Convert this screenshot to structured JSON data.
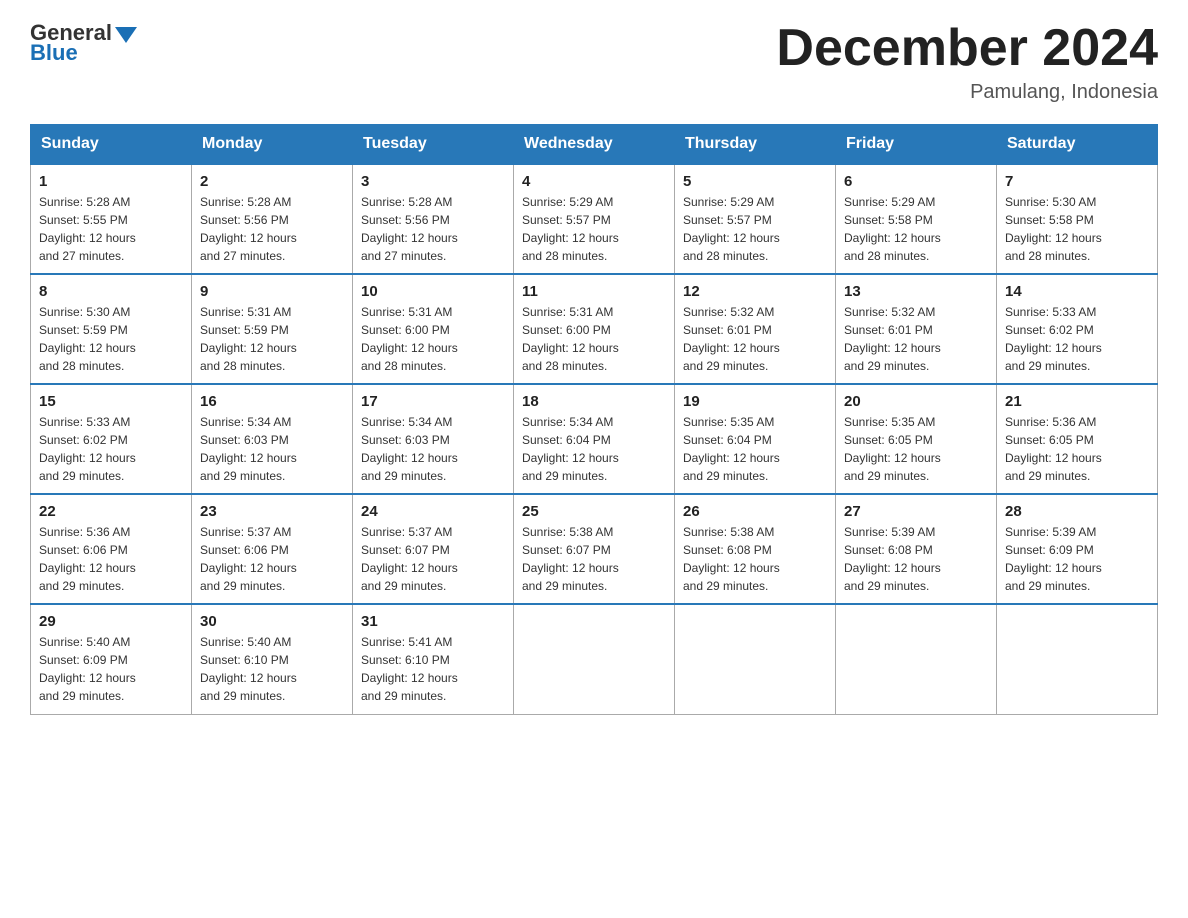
{
  "header": {
    "logo_general": "General",
    "logo_blue": "Blue",
    "month_title": "December 2024",
    "location": "Pamulang, Indonesia"
  },
  "days_of_week": [
    "Sunday",
    "Monday",
    "Tuesday",
    "Wednesday",
    "Thursday",
    "Friday",
    "Saturday"
  ],
  "weeks": [
    [
      {
        "day": "1",
        "sunrise": "5:28 AM",
        "sunset": "5:55 PM",
        "daylight": "12 hours and 27 minutes."
      },
      {
        "day": "2",
        "sunrise": "5:28 AM",
        "sunset": "5:56 PM",
        "daylight": "12 hours and 27 minutes."
      },
      {
        "day": "3",
        "sunrise": "5:28 AM",
        "sunset": "5:56 PM",
        "daylight": "12 hours and 27 minutes."
      },
      {
        "day": "4",
        "sunrise": "5:29 AM",
        "sunset": "5:57 PM",
        "daylight": "12 hours and 28 minutes."
      },
      {
        "day": "5",
        "sunrise": "5:29 AM",
        "sunset": "5:57 PM",
        "daylight": "12 hours and 28 minutes."
      },
      {
        "day": "6",
        "sunrise": "5:29 AM",
        "sunset": "5:58 PM",
        "daylight": "12 hours and 28 minutes."
      },
      {
        "day": "7",
        "sunrise": "5:30 AM",
        "sunset": "5:58 PM",
        "daylight": "12 hours and 28 minutes."
      }
    ],
    [
      {
        "day": "8",
        "sunrise": "5:30 AM",
        "sunset": "5:59 PM",
        "daylight": "12 hours and 28 minutes."
      },
      {
        "day": "9",
        "sunrise": "5:31 AM",
        "sunset": "5:59 PM",
        "daylight": "12 hours and 28 minutes."
      },
      {
        "day": "10",
        "sunrise": "5:31 AM",
        "sunset": "6:00 PM",
        "daylight": "12 hours and 28 minutes."
      },
      {
        "day": "11",
        "sunrise": "5:31 AM",
        "sunset": "6:00 PM",
        "daylight": "12 hours and 28 minutes."
      },
      {
        "day": "12",
        "sunrise": "5:32 AM",
        "sunset": "6:01 PM",
        "daylight": "12 hours and 29 minutes."
      },
      {
        "day": "13",
        "sunrise": "5:32 AM",
        "sunset": "6:01 PM",
        "daylight": "12 hours and 29 minutes."
      },
      {
        "day": "14",
        "sunrise": "5:33 AM",
        "sunset": "6:02 PM",
        "daylight": "12 hours and 29 minutes."
      }
    ],
    [
      {
        "day": "15",
        "sunrise": "5:33 AM",
        "sunset": "6:02 PM",
        "daylight": "12 hours and 29 minutes."
      },
      {
        "day": "16",
        "sunrise": "5:34 AM",
        "sunset": "6:03 PM",
        "daylight": "12 hours and 29 minutes."
      },
      {
        "day": "17",
        "sunrise": "5:34 AM",
        "sunset": "6:03 PM",
        "daylight": "12 hours and 29 minutes."
      },
      {
        "day": "18",
        "sunrise": "5:34 AM",
        "sunset": "6:04 PM",
        "daylight": "12 hours and 29 minutes."
      },
      {
        "day": "19",
        "sunrise": "5:35 AM",
        "sunset": "6:04 PM",
        "daylight": "12 hours and 29 minutes."
      },
      {
        "day": "20",
        "sunrise": "5:35 AM",
        "sunset": "6:05 PM",
        "daylight": "12 hours and 29 minutes."
      },
      {
        "day": "21",
        "sunrise": "5:36 AM",
        "sunset": "6:05 PM",
        "daylight": "12 hours and 29 minutes."
      }
    ],
    [
      {
        "day": "22",
        "sunrise": "5:36 AM",
        "sunset": "6:06 PM",
        "daylight": "12 hours and 29 minutes."
      },
      {
        "day": "23",
        "sunrise": "5:37 AM",
        "sunset": "6:06 PM",
        "daylight": "12 hours and 29 minutes."
      },
      {
        "day": "24",
        "sunrise": "5:37 AM",
        "sunset": "6:07 PM",
        "daylight": "12 hours and 29 minutes."
      },
      {
        "day": "25",
        "sunrise": "5:38 AM",
        "sunset": "6:07 PM",
        "daylight": "12 hours and 29 minutes."
      },
      {
        "day": "26",
        "sunrise": "5:38 AM",
        "sunset": "6:08 PM",
        "daylight": "12 hours and 29 minutes."
      },
      {
        "day": "27",
        "sunrise": "5:39 AM",
        "sunset": "6:08 PM",
        "daylight": "12 hours and 29 minutes."
      },
      {
        "day": "28",
        "sunrise": "5:39 AM",
        "sunset": "6:09 PM",
        "daylight": "12 hours and 29 minutes."
      }
    ],
    [
      {
        "day": "29",
        "sunrise": "5:40 AM",
        "sunset": "6:09 PM",
        "daylight": "12 hours and 29 minutes."
      },
      {
        "day": "30",
        "sunrise": "5:40 AM",
        "sunset": "6:10 PM",
        "daylight": "12 hours and 29 minutes."
      },
      {
        "day": "31",
        "sunrise": "5:41 AM",
        "sunset": "6:10 PM",
        "daylight": "12 hours and 29 minutes."
      },
      {
        "day": "",
        "sunrise": "",
        "sunset": "",
        "daylight": ""
      },
      {
        "day": "",
        "sunrise": "",
        "sunset": "",
        "daylight": ""
      },
      {
        "day": "",
        "sunrise": "",
        "sunset": "",
        "daylight": ""
      },
      {
        "day": "",
        "sunrise": "",
        "sunset": "",
        "daylight": ""
      }
    ]
  ],
  "labels": {
    "sunrise": "Sunrise:",
    "sunset": "Sunset:",
    "daylight": "Daylight:"
  }
}
